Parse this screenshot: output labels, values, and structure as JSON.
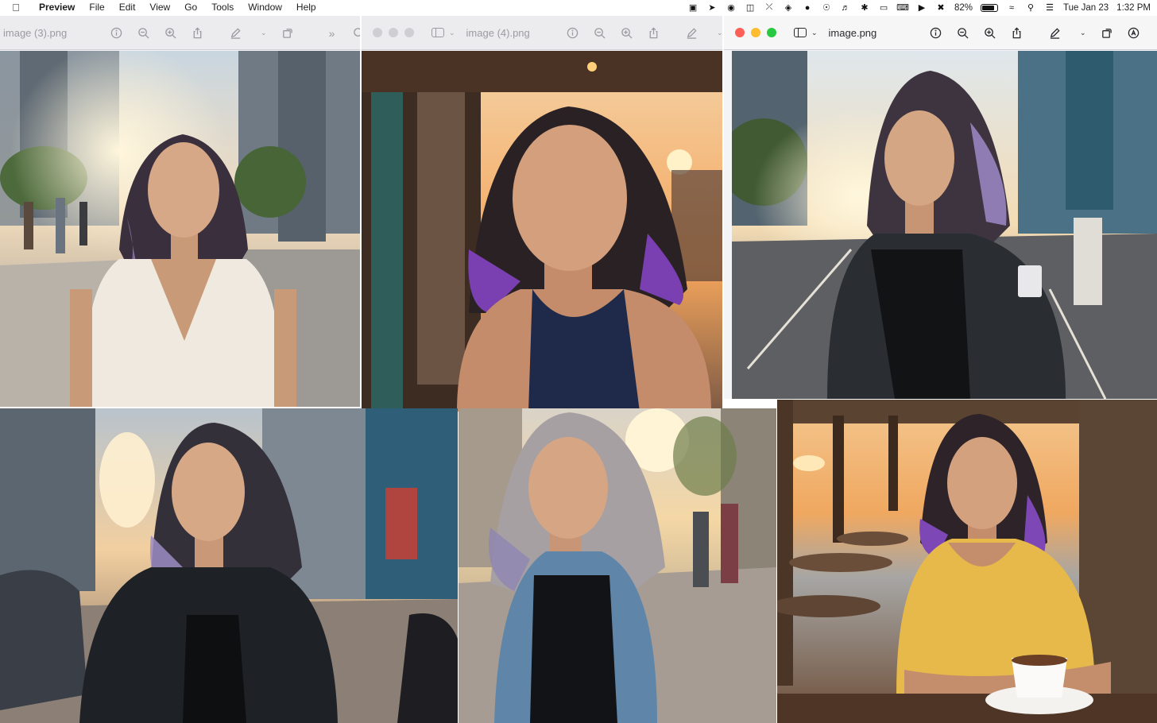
{
  "menubar": {
    "app_name": "Preview",
    "menus": [
      "File",
      "Edit",
      "View",
      "Go",
      "Tools",
      "Window",
      "Help"
    ],
    "battery_percent": "82%",
    "battery_level": 0.82,
    "date": "Tue Jan 23",
    "time": "1:32 PM"
  },
  "windows": [
    {
      "title": "image (3).png",
      "active": false
    },
    {
      "title": "image (4).png",
      "active": false
    },
    {
      "title": "image.png",
      "active": true
    }
  ],
  "icons": {
    "info": "info-icon",
    "zoom_out": "zoom-out-icon",
    "zoom_in": "zoom-in-icon",
    "share": "share-icon",
    "markup": "markup-pen-icon",
    "rotate": "rotate-icon",
    "annotate": "annotate-icon",
    "more": "more-chevrons-icon",
    "search": "search-icon"
  },
  "photos": [
    {
      "scene": "city street at sunset",
      "outfit": "white lace dress",
      "outfit_color": "#efe9df"
    },
    {
      "scene": "wooden cafe at sunset",
      "outfit": "navy tank top",
      "outfit_color": "#1f2a4a"
    },
    {
      "scene": "city road at sunset",
      "outfit": "black jacket",
      "outfit_color": "#2a2e33"
    },
    {
      "scene": "city street at sunset",
      "outfit": "black leather jacket",
      "outfit_color": "#1e2126"
    },
    {
      "scene": "sidewalk at sunset",
      "outfit": "denim jacket",
      "outfit_color": "#5f86a8"
    },
    {
      "scene": "beach cafe at sunset",
      "outfit": "yellow t-shirt",
      "outfit_color": "#e7b84a"
    }
  ]
}
